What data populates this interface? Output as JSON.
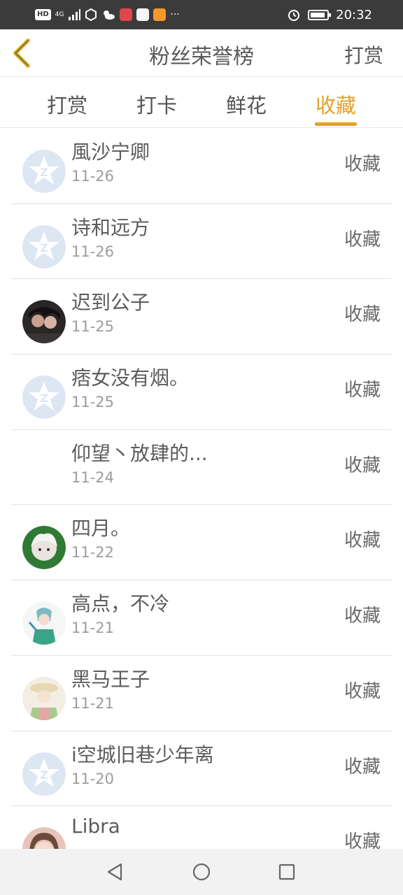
{
  "status_bar": {
    "network": "HD",
    "signal": "4G",
    "more": "···",
    "time": "20:32"
  },
  "header": {
    "title": "粉丝荣誉榜",
    "action_label": "打赏"
  },
  "tabs": [
    {
      "label": "打赏"
    },
    {
      "label": "打卡"
    },
    {
      "label": "鲜花"
    },
    {
      "label": "收藏"
    }
  ],
  "active_tab": "收藏",
  "accent_color": "#e5a12a",
  "list": [
    {
      "name": "風沙宁卿",
      "date": "11-26",
      "action": "收藏",
      "avatar": "default-qq-avatar"
    },
    {
      "name": "诗和远方",
      "date": "11-26",
      "action": "收藏",
      "avatar": "default-qq-avatar"
    },
    {
      "name": "迟到公子",
      "date": "11-25",
      "action": "收藏",
      "avatar": "photo-avatar"
    },
    {
      "name": "痞女没有烟。",
      "date": "11-25",
      "action": "收藏",
      "avatar": "default-qq-avatar"
    },
    {
      "name": "仰望丶放肆的...",
      "date": "11-24",
      "action": "收藏",
      "avatar": "blank-avatar"
    },
    {
      "name": "四月。",
      "date": "11-22",
      "action": "收藏",
      "avatar": "anime-avatar"
    },
    {
      "name": "高点，不冷",
      "date": "11-21",
      "action": "收藏",
      "avatar": "anime-avatar"
    },
    {
      "name": "黑马王子",
      "date": "11-21",
      "action": "收藏",
      "avatar": "anime-avatar"
    },
    {
      "name": "i空城旧巷少年离",
      "date": "11-20",
      "action": "收藏",
      "avatar": "default-qq-avatar"
    },
    {
      "name": "Libra",
      "date": "",
      "action": "收藏",
      "avatar": "illustration-avatar"
    }
  ],
  "nav_bar": {
    "buttons": [
      "back-triangle-icon",
      "home-circle-icon",
      "recents-square-icon"
    ]
  }
}
